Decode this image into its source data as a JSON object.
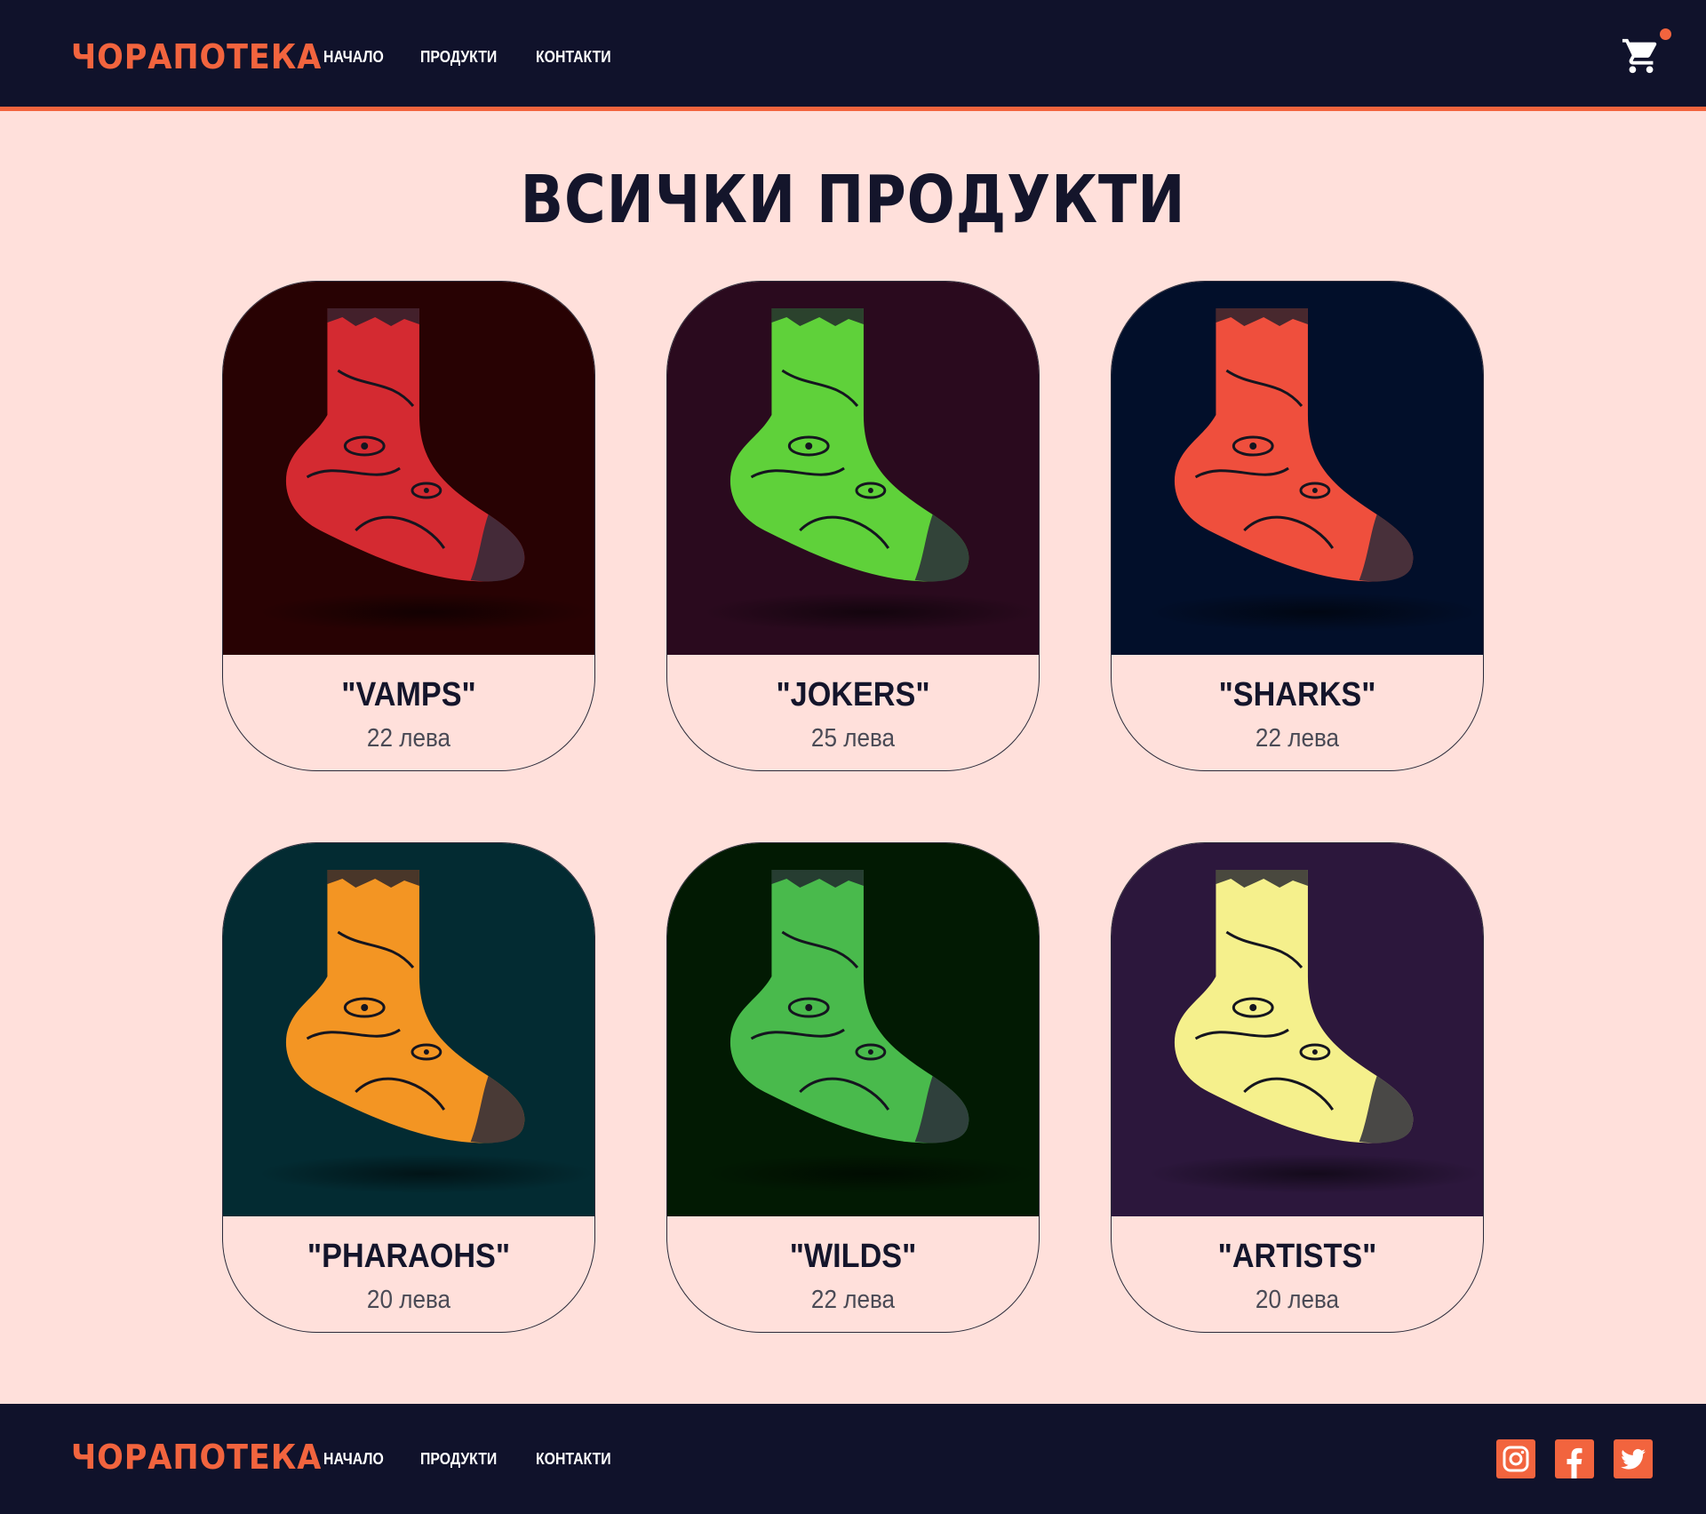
{
  "brand": {
    "logo_text": "ЧОРАПОТЕКА",
    "accent_color": "#f2643e",
    "dark_color": "#10122b",
    "bg_color": "#ffe0db"
  },
  "header": {
    "nav": [
      {
        "label": "НАЧАЛО"
      },
      {
        "label": "ПРОДУКТИ"
      },
      {
        "label": "КОНТАКТИ"
      }
    ],
    "cart_icon": "shopping-cart-icon"
  },
  "main": {
    "title": "ВСИЧКИ ПРОДУКТИ",
    "products": [
      {
        "name": "\"VAMPS\"",
        "price": "22 лева",
        "sock_color": "#d42a31",
        "bg_color": "#280203"
      },
      {
        "name": "\"JOKERS\"",
        "price": "25 лева",
        "sock_color": "#5fd13a",
        "bg_color": "#2a0a1e"
      },
      {
        "name": "\"SHARKS\"",
        "price": "22 лева",
        "sock_color": "#ef4f3d",
        "bg_color": "#020f2a"
      },
      {
        "name": "\"PHARAOHS\"",
        "price": "20 лева",
        "sock_color": "#f39523",
        "bg_color": "#032b32"
      },
      {
        "name": "\"WILDS\"",
        "price": "22 лева",
        "sock_color": "#49ba4c",
        "bg_color": "#021a03"
      },
      {
        "name": "\"ARTISTS\"",
        "price": "20 лева",
        "sock_color": "#f5f08c",
        "bg_color": "#2c173c"
      }
    ]
  },
  "footer": {
    "nav": [
      {
        "label": "НАЧАЛО"
      },
      {
        "label": "ПРОДУКТИ"
      },
      {
        "label": "КОНТАКТИ"
      }
    ],
    "social_icons": [
      "instagram-icon",
      "facebook-icon",
      "twitter-icon"
    ]
  }
}
